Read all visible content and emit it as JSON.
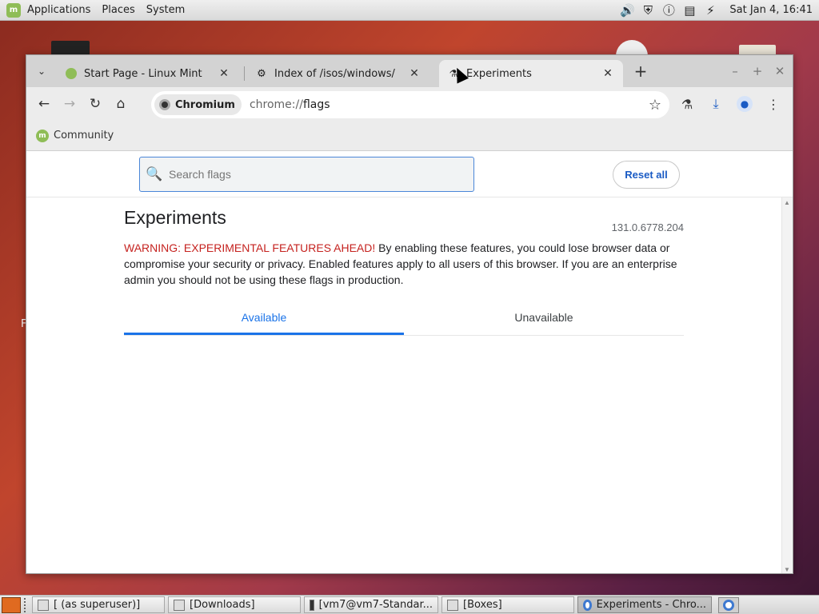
{
  "top_panel": {
    "menus": [
      "Applications",
      "Places",
      "System"
    ],
    "clock": "Sat Jan  4, 16:41"
  },
  "desktop": {
    "letter": "F"
  },
  "browser": {
    "tabs": [
      {
        "title": "Start Page - Linux Mint",
        "icon": "linux-mint-icon"
      },
      {
        "title": "Index of /isos/windows/",
        "icon": "server-icon"
      },
      {
        "title": "Experiments",
        "icon": "flask-icon",
        "active": true
      }
    ],
    "omnibox": {
      "chip": "Chromium",
      "url_scheme": "chrome://",
      "url_path": "flags"
    },
    "bookmarks": [
      {
        "label": "Community"
      }
    ]
  },
  "page": {
    "search_placeholder": "Search flags",
    "reset_label": "Reset all",
    "title": "Experiments",
    "version": "131.0.6778.204",
    "warning_prefix": "WARNING: EXPERIMENTAL FEATURES AHEAD!",
    "warning_text": " By enabling these features, you could lose browser data or compromise your security or privacy. Enabled features apply to all users of this browser. If you are an enterprise admin you should not be using these flags in production.",
    "tabs": [
      "Available",
      "Unavailable"
    ]
  },
  "taskbar": {
    "items": [
      {
        "label": "[ (as superuser)]"
      },
      {
        "label": "[Downloads]"
      },
      {
        "label": "[vm7@vm7-Standar..."
      },
      {
        "label": "[Boxes]"
      },
      {
        "label": "Experiments - Chro...",
        "active": true
      }
    ]
  },
  "colors": {
    "accent": "#1a73e8",
    "warning": "#c5221f",
    "mint": "#8fbd57"
  }
}
